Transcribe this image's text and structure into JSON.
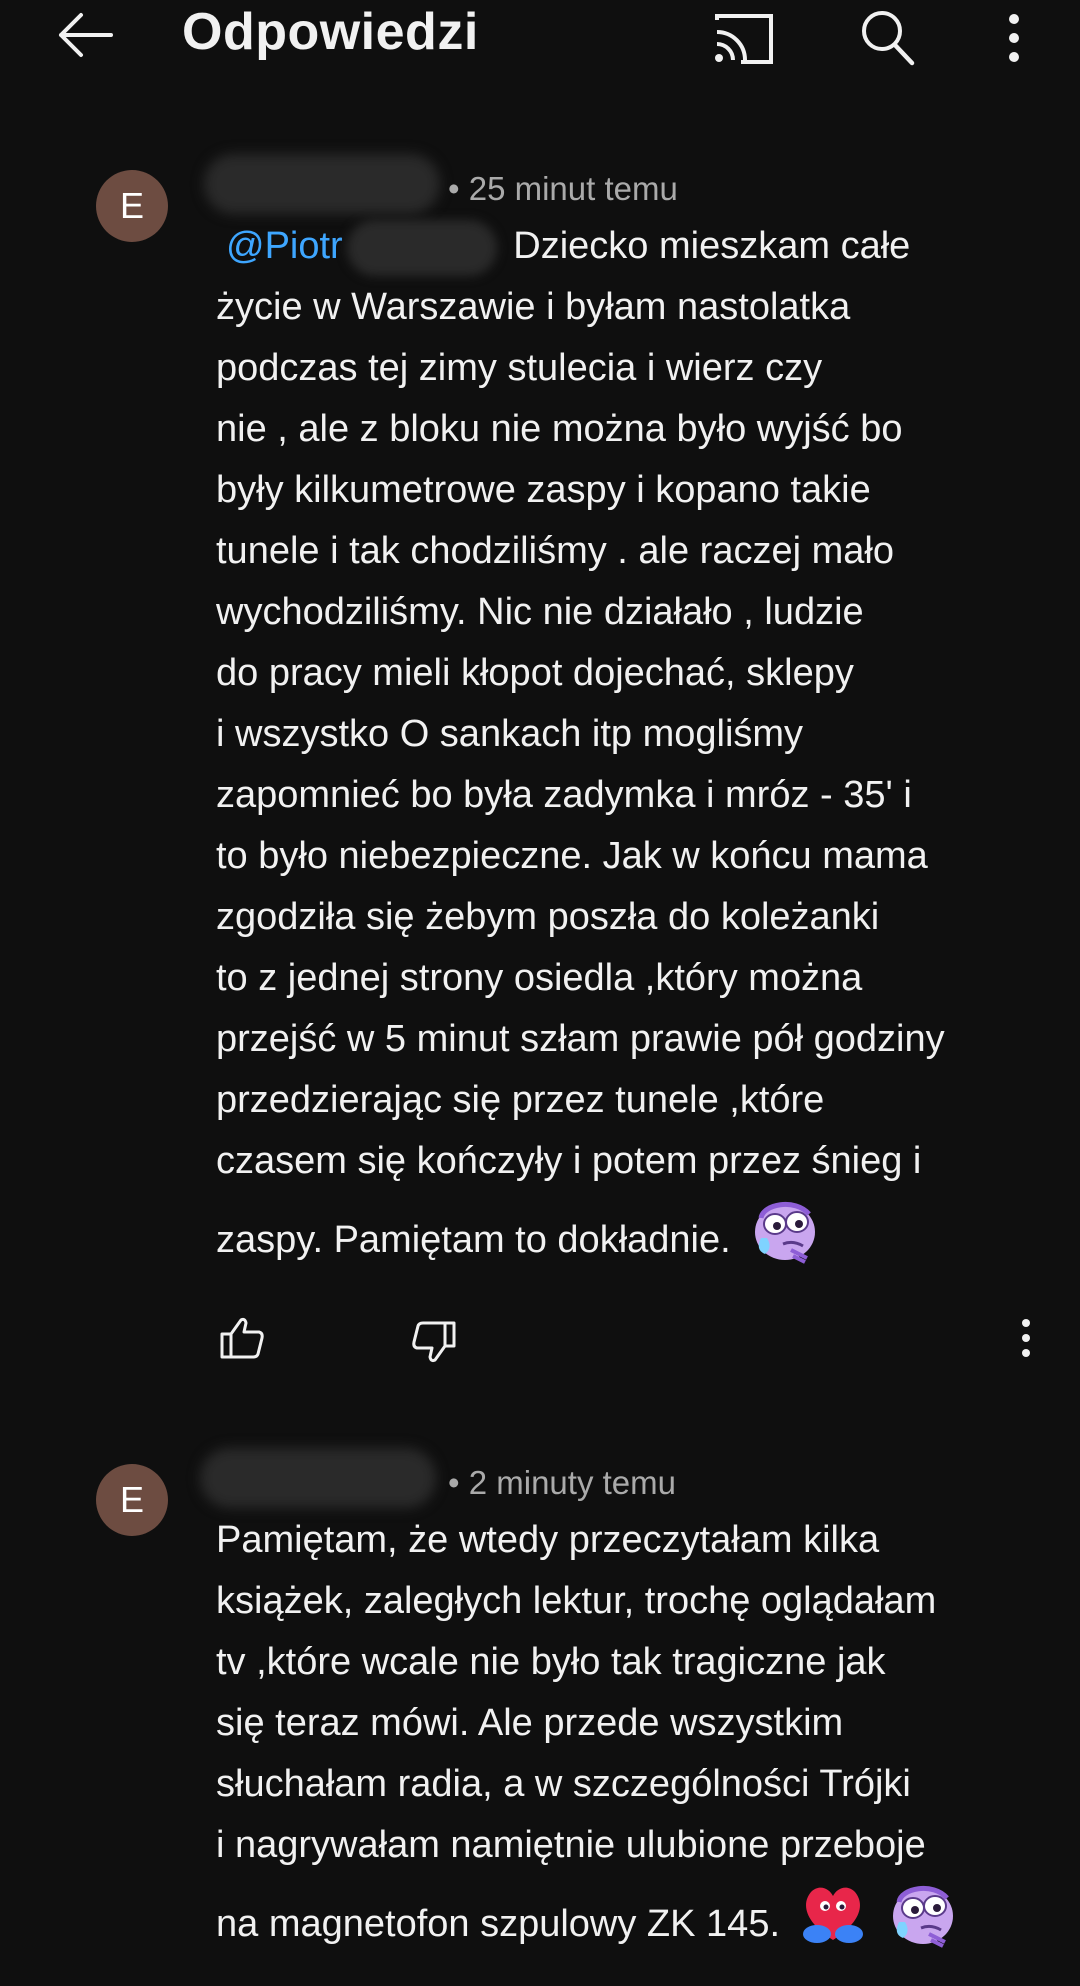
{
  "header": {
    "title": "Odpowiedzi",
    "back_icon": "arrow-left-icon",
    "cast_icon": "cast-icon",
    "search_icon": "search-icon",
    "more_icon": "more-vertical-icon"
  },
  "comments": [
    {
      "avatar_letter": "E",
      "time": "• 25 minut temu",
      "mention": "@Piotr",
      "lines": [
        "Dziecko mieszkam całe",
        "życie w Warszawie i byłam nastolatka",
        "podczas tej zimy stulecia i wierz czy",
        "nie , ale z bloku nie można było wyjść bo",
        "były kilkumetrowe zaspy i kopano takie",
        "tunele i tak chodziliśmy . ale raczej mało",
        "wychodziliśmy.  Nic nie działało , ludzie",
        "do pracy mieli kłopot dojechać, sklepy",
        "i wszystko O sankach itp mogliśmy",
        "zapomnieć bo była zadymka i mróz - 35' i",
        "to było niebezpieczne. Jak w końcu mama",
        "zgodziła się żebym poszła do koleżanki",
        "to z jednej strony osiedla ,który można",
        "przejść w 5 minut szłam prawie pół godziny",
        "przedzierając się przez tunele ,które",
        "czasem się kończyły i potem przez śnieg i",
        "zaspy. Pamiętam to dokładnie."
      ],
      "sticker": "teary-purple-face-sticker"
    },
    {
      "avatar_letter": "E",
      "time": "• 2 minuty temu",
      "lines": [
        "Pamiętam, że wtedy przeczytałam kilka",
        "książek, zaległych lektur, trochę oglądałam",
        "tv ,które wcale nie było tak tragiczne jak",
        "się teraz mówi. Ale przede wszystkim",
        "słuchałam radia, a w szczególności Trójki",
        "i nagrywałam namiętnie ulubione przeboje",
        "na magnetofon szpulowy ZK 145."
      ],
      "stickers": [
        "heart-hug-sticker",
        "teary-purple-face-sticker"
      ]
    }
  ],
  "colors": {
    "background": "#0f0f0f",
    "text": "#f1f1f1",
    "secondary_text": "#aaaaaa",
    "mention": "#3ea6ff",
    "avatar": "#6d4c41"
  }
}
